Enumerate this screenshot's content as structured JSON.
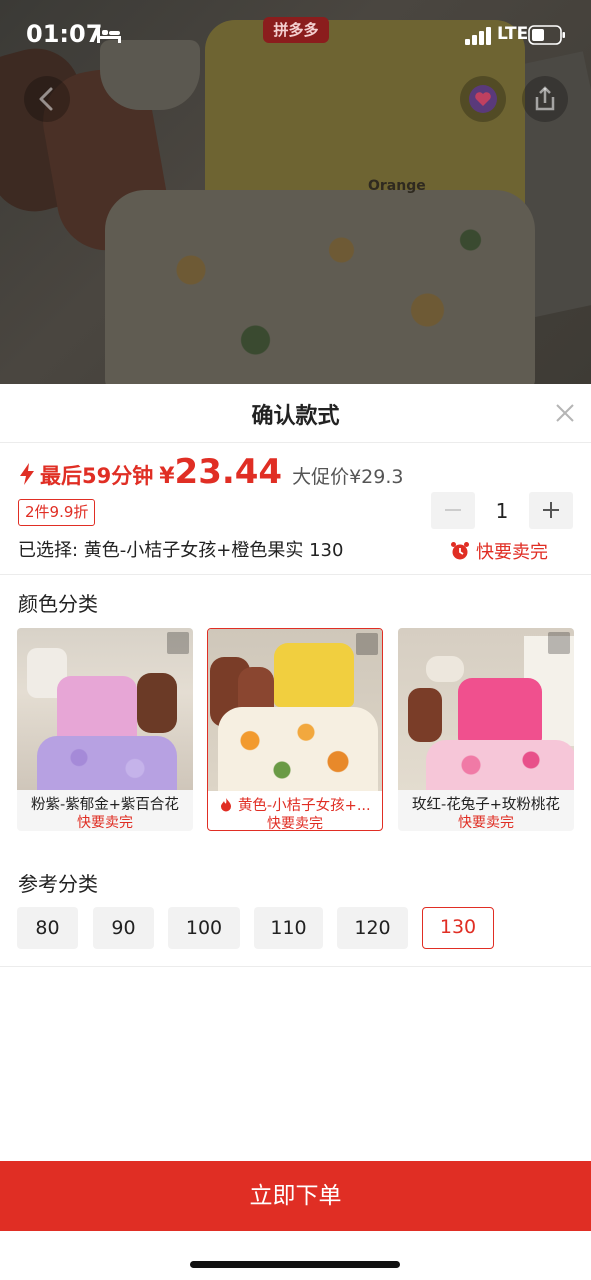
{
  "status_bar": {
    "time": "01:07",
    "network": "LTE"
  },
  "app_badge": "拼多多",
  "hero": {
    "shirt_print_text": "Orange"
  },
  "sheet": {
    "title": "确认款式"
  },
  "price": {
    "countdown": "最后59分钟",
    "symbol": "¥",
    "value": "23.44",
    "promo": "大促价¥29.3"
  },
  "discount_tag": "2件9.9折",
  "quantity": "1",
  "selected": "已选择: 黄色-小桔子女孩+橙色果实 130",
  "selling_fast": "快要卖完",
  "color_section": {
    "title": "颜色分类",
    "options": [
      {
        "label": "粉紫-紫郁金+紫百合花",
        "status": "快要卖完"
      },
      {
        "label": "黄色-小桔子女孩+...",
        "status": "快要卖完"
      },
      {
        "label": "玫红-花兔子+玫粉桃花",
        "status": "快要卖完"
      }
    ]
  },
  "size_section": {
    "title": "参考分类",
    "options": [
      "80",
      "90",
      "100",
      "110",
      "120",
      "130"
    ],
    "selected": "130"
  },
  "order_button": "立即下单",
  "colors": {
    "accent": "#e02e24"
  }
}
